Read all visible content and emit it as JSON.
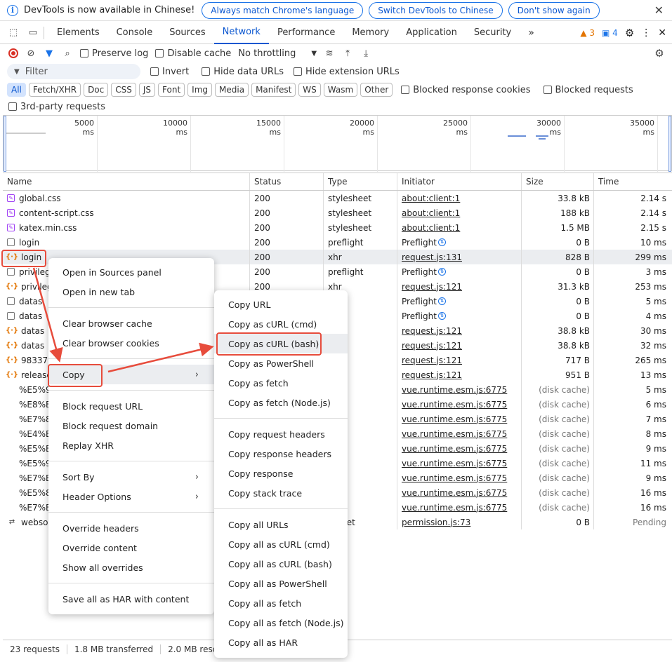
{
  "infobar": {
    "message": "DevTools is now available in Chinese!",
    "btn_match": "Always match Chrome's language",
    "btn_switch": "Switch DevTools to Chinese",
    "btn_dont": "Don't show again"
  },
  "tabs": [
    "Elements",
    "Console",
    "Sources",
    "Network",
    "Performance",
    "Memory",
    "Application",
    "Security"
  ],
  "badges": {
    "warnings": "3",
    "messages": "4"
  },
  "toolbar": {
    "preserve_log": "Preserve log",
    "disable_cache": "Disable cache",
    "throttling": "No throttling"
  },
  "filter": {
    "placeholder": "Filter",
    "invert": "Invert",
    "hide_data_urls": "Hide data URLs",
    "hide_ext_urls": "Hide extension URLs"
  },
  "chips": [
    "All",
    "Fetch/XHR",
    "Doc",
    "CSS",
    "JS",
    "Font",
    "Img",
    "Media",
    "Manifest",
    "WS",
    "Wasm",
    "Other"
  ],
  "chip_checks": {
    "blocked_cookies": "Blocked response cookies",
    "blocked_requests": "Blocked requests",
    "third_party": "3rd-party requests"
  },
  "overview_ticks": [
    "5000 ms",
    "10000 ms",
    "15000 ms",
    "20000 ms",
    "25000 ms",
    "30000 ms",
    "35000 ms"
  ],
  "columns": {
    "name": "Name",
    "status": "Status",
    "type": "Type",
    "initiator": "Initiator",
    "size": "Size",
    "time": "Time"
  },
  "rows": [
    {
      "icon": "css",
      "name": "global.css",
      "status": "200",
      "type": "stylesheet",
      "initiator": "about:client:1",
      "init_link": true,
      "size": "33.8 kB",
      "time": "2.14 s"
    },
    {
      "icon": "css",
      "name": "content-script.css",
      "status": "200",
      "type": "stylesheet",
      "initiator": "about:client:1",
      "init_link": true,
      "size": "188 kB",
      "time": "2.14 s"
    },
    {
      "icon": "css",
      "name": "katex.min.css",
      "status": "200",
      "type": "stylesheet",
      "initiator": "about:client:1",
      "init_link": true,
      "size": "1.5 MB",
      "time": "2.15 s"
    },
    {
      "icon": "doc",
      "name": "login",
      "status": "200",
      "type": "preflight",
      "initiator": "Preflight",
      "preflight": true,
      "size": "0 B",
      "time": "10 ms"
    },
    {
      "icon": "xhr",
      "name": "login",
      "status": "200",
      "type": "xhr",
      "initiator": "request.js:131",
      "init_link": true,
      "size": "828 B",
      "time": "299 ms"
    },
    {
      "icon": "doc",
      "name": "privileg",
      "status": "200",
      "type": "preflight",
      "initiator": "Preflight",
      "preflight": true,
      "size": "0 B",
      "time": "3 ms"
    },
    {
      "icon": "xhr",
      "name": "privileg",
      "status": "200",
      "type": "xhr",
      "initiator": "request.js:121",
      "init_link": true,
      "size": "31.3 kB",
      "time": "253 ms"
    },
    {
      "icon": "doc",
      "name": "datas",
      "status": "",
      "type": "ight",
      "initiator": "Preflight",
      "preflight": true,
      "size": "0 B",
      "time": "5 ms"
    },
    {
      "icon": "doc",
      "name": "datas",
      "status": "",
      "type": "ight",
      "initiator": "Preflight",
      "preflight": true,
      "size": "0 B",
      "time": "4 ms"
    },
    {
      "icon": "xhr",
      "name": "datas",
      "status": "",
      "type": "",
      "initiator": "request.js:121",
      "init_link": true,
      "size": "38.8 kB",
      "time": "30 ms"
    },
    {
      "icon": "xhr",
      "name": "datas",
      "status": "",
      "type": "",
      "initiator": "request.js:121",
      "init_link": true,
      "size": "38.8 kB",
      "time": "32 ms"
    },
    {
      "icon": "xhr",
      "name": "983379",
      "status": "",
      "type": "",
      "initiator": "request.js:121",
      "init_link": true,
      "size": "717 B",
      "time": "265 ms"
    },
    {
      "icon": "xhr",
      "name": "release",
      "status": "",
      "type": "",
      "initiator": "request.js:121",
      "init_link": true,
      "size": "951 B",
      "time": "13 ms"
    },
    {
      "icon": "none",
      "name": "%E5%9",
      "status": "",
      "type": "",
      "initiator": "vue.runtime.esm.js:6775",
      "init_link": true,
      "size": "(disk cache)",
      "time": "5 ms"
    },
    {
      "icon": "none",
      "name": "%E8%B",
      "status": "",
      "type": "",
      "initiator": "vue.runtime.esm.js:6775",
      "init_link": true,
      "size": "(disk cache)",
      "time": "6 ms"
    },
    {
      "icon": "none",
      "name": "%E7%8",
      "status": "",
      "type": "",
      "initiator": "vue.runtime.esm.js:6775",
      "init_link": true,
      "size": "(disk cache)",
      "time": "7 ms"
    },
    {
      "icon": "none",
      "name": "%E4%B",
      "status": "",
      "type": "",
      "initiator": "vue.runtime.esm.js:6775",
      "init_link": true,
      "size": "(disk cache)",
      "time": "8 ms"
    },
    {
      "icon": "none",
      "name": "%E5%B",
      "status": "",
      "type": "",
      "initiator": "vue.runtime.esm.js:6775",
      "init_link": true,
      "size": "(disk cache)",
      "time": "9 ms"
    },
    {
      "icon": "none",
      "name": "%E5%9",
      "status": "",
      "type": "",
      "initiator": "vue.runtime.esm.js:6775",
      "init_link": true,
      "size": "(disk cache)",
      "time": "11 ms"
    },
    {
      "icon": "none",
      "name": "%E7%B",
      "status": "",
      "type": "",
      "initiator": "vue.runtime.esm.js:6775",
      "init_link": true,
      "size": "(disk cache)",
      "time": "9 ms"
    },
    {
      "icon": "none",
      "name": "%E5%8",
      "status": "",
      "type": "",
      "initiator": "vue.runtime.esm.js:6775",
      "init_link": true,
      "size": "(disk cache)",
      "time": "16 ms"
    },
    {
      "icon": "none",
      "name": "%E7%B",
      "status": "",
      "type": "",
      "initiator": "vue.runtime.esm.js:6775",
      "init_link": true,
      "size": "(disk cache)",
      "time": "16 ms"
    },
    {
      "icon": "ws",
      "name": "websoc",
      "status": "",
      "type": "socket",
      "initiator": "permission.js:73",
      "init_link": true,
      "size": "0 B",
      "time": "Pending"
    }
  ],
  "statusbar": {
    "requests": "23 requests",
    "transferred": "1.8 MB transferred",
    "resources": "2.0 MB resour"
  },
  "menu1": {
    "open_sources": "Open in Sources panel",
    "open_tab": "Open in new tab",
    "clear_cache": "Clear browser cache",
    "clear_cookies": "Clear browser cookies",
    "copy": "Copy",
    "block_url": "Block request URL",
    "block_domain": "Block request domain",
    "replay": "Replay XHR",
    "sort_by": "Sort By",
    "header_options": "Header Options",
    "override_headers": "Override headers",
    "override_content": "Override content",
    "show_overrides": "Show all overrides",
    "save_har": "Save all as HAR with content"
  },
  "menu2": {
    "copy_url": "Copy URL",
    "copy_curl_cmd": "Copy as cURL (cmd)",
    "copy_curl_bash": "Copy as cURL (bash)",
    "copy_ps": "Copy as PowerShell",
    "copy_fetch": "Copy as fetch",
    "copy_fetch_node": "Copy as fetch (Node.js)",
    "copy_req_headers": "Copy request headers",
    "copy_resp_headers": "Copy response headers",
    "copy_response": "Copy response",
    "copy_stack": "Copy stack trace",
    "copy_all_urls": "Copy all URLs",
    "copy_all_curl_cmd": "Copy all as cURL (cmd)",
    "copy_all_curl_bash": "Copy all as cURL (bash)",
    "copy_all_ps": "Copy all as PowerShell",
    "copy_all_fetch": "Copy all as fetch",
    "copy_all_fetch_node": "Copy all as fetch (Node.js)",
    "copy_all_har": "Copy all as HAR"
  }
}
